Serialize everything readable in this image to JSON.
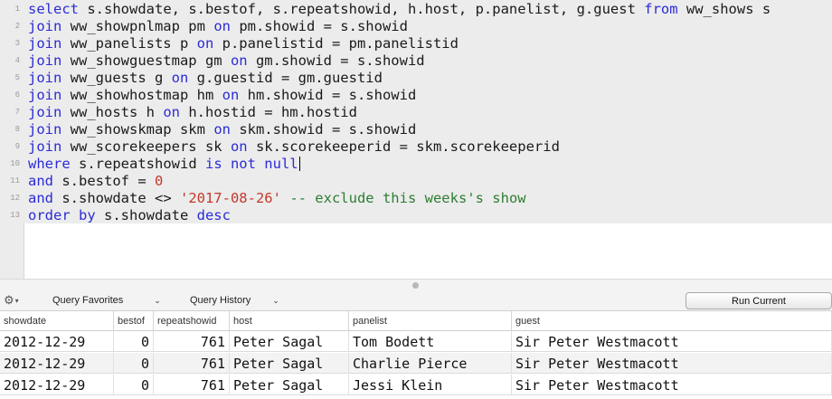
{
  "editor": {
    "lines": [
      [
        {
          "t": "select",
          "c": "kw"
        },
        {
          "t": " s.showdate, s.bestof, s.repeatshowid, h.host, p.panelist, g.guest "
        },
        {
          "t": "from",
          "c": "kw"
        },
        {
          "t": " ww_shows s"
        }
      ],
      [
        {
          "t": "join",
          "c": "kw"
        },
        {
          "t": " ww_showpnlmap pm "
        },
        {
          "t": "on",
          "c": "kw"
        },
        {
          "t": " pm.showid = s.showid"
        }
      ],
      [
        {
          "t": "join",
          "c": "kw"
        },
        {
          "t": " ww_panelists p "
        },
        {
          "t": "on",
          "c": "kw"
        },
        {
          "t": " p.panelistid = pm.panelistid"
        }
      ],
      [
        {
          "t": "join",
          "c": "kw"
        },
        {
          "t": " ww_showguestmap gm "
        },
        {
          "t": "on",
          "c": "kw"
        },
        {
          "t": " gm.showid = s.showid"
        }
      ],
      [
        {
          "t": "join",
          "c": "kw"
        },
        {
          "t": " ww_guests g "
        },
        {
          "t": "on",
          "c": "kw"
        },
        {
          "t": " g.guestid = gm.guestid"
        }
      ],
      [
        {
          "t": "join",
          "c": "kw"
        },
        {
          "t": " ww_showhostmap hm "
        },
        {
          "t": "on",
          "c": "kw"
        },
        {
          "t": " hm.showid = s.showid"
        }
      ],
      [
        {
          "t": "join",
          "c": "kw"
        },
        {
          "t": " ww_hosts h "
        },
        {
          "t": "on",
          "c": "kw"
        },
        {
          "t": " h.hostid = hm.hostid"
        }
      ],
      [
        {
          "t": "join",
          "c": "kw"
        },
        {
          "t": " ww_showskmap skm "
        },
        {
          "t": "on",
          "c": "kw"
        },
        {
          "t": " skm.showid = s.showid"
        }
      ],
      [
        {
          "t": "join",
          "c": "kw"
        },
        {
          "t": " ww_scorekeepers sk "
        },
        {
          "t": "on",
          "c": "kw"
        },
        {
          "t": " sk.scorekeeperid = skm.scorekeeperid"
        }
      ],
      [
        {
          "t": "where",
          "c": "kw"
        },
        {
          "t": " s.repeatshowid "
        },
        {
          "t": "is not null",
          "c": "kw"
        },
        {
          "t": "",
          "caret": true
        }
      ],
      [
        {
          "t": "and",
          "c": "kw"
        },
        {
          "t": " s.bestof = "
        },
        {
          "t": "0",
          "c": "num"
        }
      ],
      [
        {
          "t": "and",
          "c": "kw"
        },
        {
          "t": " s.showdate <> "
        },
        {
          "t": "'2017-08-26'",
          "c": "str"
        },
        {
          "t": " "
        },
        {
          "t": "-- exclude this weeks's show",
          "c": "cmt"
        }
      ],
      [
        {
          "t": "order by",
          "c": "kw"
        },
        {
          "t": " s.showdate "
        },
        {
          "t": "desc",
          "c": "kw"
        }
      ]
    ]
  },
  "toolbar": {
    "favorites_label": "Query Favorites",
    "history_label": "Query History",
    "run_label": "Run Current",
    "gear_icon": "gear-icon"
  },
  "results": {
    "columns": [
      "showdate",
      "bestof",
      "repeatshowid",
      "host",
      "panelist",
      "guest"
    ],
    "rows": [
      [
        "2012-12-29",
        "0",
        "761",
        "Peter Sagal",
        "Tom Bodett",
        "Sir Peter Westmacott"
      ],
      [
        "2012-12-29",
        "0",
        "761",
        "Peter Sagal",
        "Charlie Pierce",
        "Sir Peter Westmacott"
      ],
      [
        "2012-12-29",
        "0",
        "761",
        "Peter Sagal",
        "Jessi Klein",
        "Sir Peter Westmacott"
      ]
    ]
  }
}
